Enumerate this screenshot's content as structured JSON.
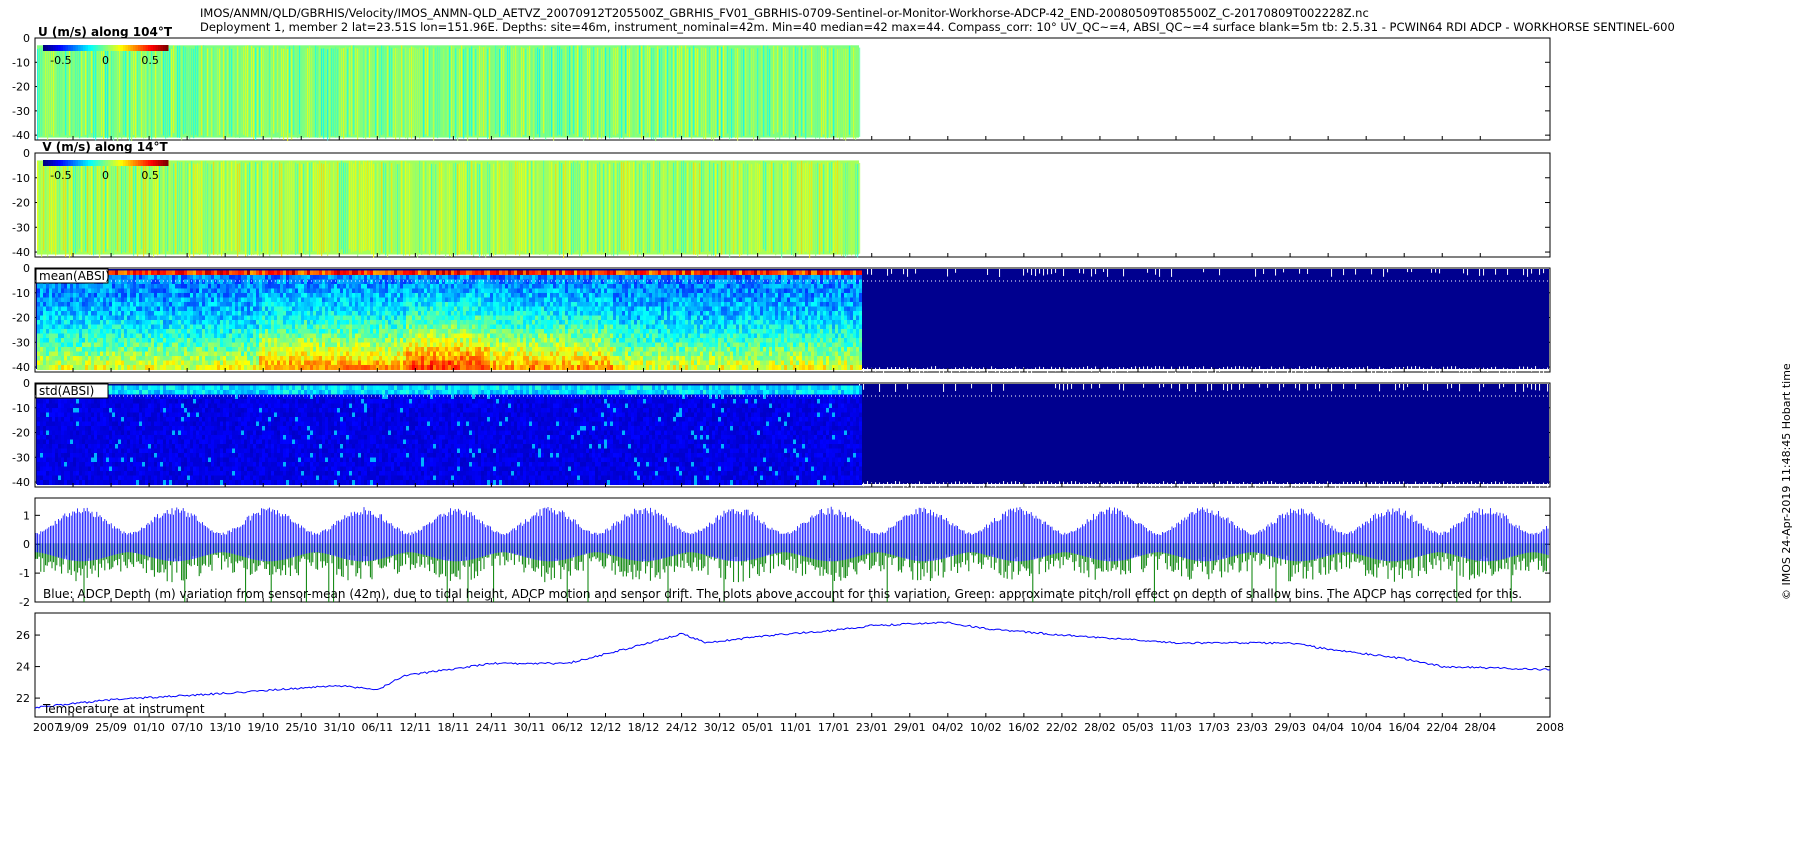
{
  "title": {
    "line1": "IMOS/ANMN/QLD/GBRHIS/Velocity/IMOS_ANMN-QLD_AETVZ_20070912T205500Z_GBRHIS_FV01_GBRHIS-0709-Sentinel-or-Monitor-Workhorse-ADCP-42_END-20080509T085500Z_C-20170809T002228Z.nc",
    "line2": "Deployment 1, member 2 lat=23.51S lon=151.96E. Depths: site=46m, instrument_nominal=42m. Min=40 median=42 max=44. Compass_corr: 10° UV_QC~=4, ABSI_QC~=4 surface blank=5m tb: 2.5.31 - PCWIN64 RDI ADCP - WORKHORSE SENTINEL-600"
  },
  "side_stamp": "© IMOS 24-Apr-2019 11:48:45 Hobart time",
  "colors": {
    "u_v_field": "#6fd23a",
    "absi_background": "#00008f",
    "depth_line": "#0000ff",
    "pitch_roll_effect": "#007f00",
    "temperature_line": "#0000ff"
  },
  "colormap": "jet",
  "chart_data": [
    {
      "type": "heatmap",
      "name": "U",
      "label": "U (m/s) along 104°T",
      "colorbar_ticks": [
        "-0.5",
        "0",
        "0.5"
      ],
      "clim": [
        -0.7,
        0.7
      ],
      "yticks": [
        "0",
        "-10",
        "-20",
        "-30",
        "-40"
      ],
      "ylim": [
        -42,
        0
      ],
      "data_end_date": "2008-01-21",
      "typical_value": 0.0
    },
    {
      "type": "heatmap",
      "name": "V",
      "label": "V (m/s) along 14°T",
      "colorbar_ticks": [
        "-0.5",
        "0",
        "0.5"
      ],
      "clim": [
        -0.7,
        0.7
      ],
      "yticks": [
        "0",
        "-10",
        "-20",
        "-30",
        "-40"
      ],
      "ylim": [
        -42,
        0
      ],
      "data_end_date": "2008-01-21",
      "typical_value": 0.05
    },
    {
      "type": "heatmap",
      "name": "mean(ABSI)",
      "label": "mean(ABSI)",
      "yticks": [
        "0",
        "-10",
        "-20",
        "-30",
        "-40"
      ],
      "ylim": [
        -42,
        0
      ],
      "data_end_date": "2008-01-21"
    },
    {
      "type": "heatmap",
      "name": "std(ABSI)",
      "label": "std(ABSI)",
      "yticks": [
        "0",
        "-10",
        "-20",
        "-30",
        "-40"
      ],
      "ylim": [
        -42,
        0
      ],
      "data_end_date": "2008-01-21"
    },
    {
      "type": "line",
      "name": "depth-variation",
      "annotation": "Blue: ADCP Depth (m) variation from sensor-mean (42m), due to tidal height, ADCP motion and sensor drift. The plots above account for this variation. Green: approximate pitch/roll effect on depth of shallow bins. The ADCP has corrected for this.",
      "yticks": [
        "1",
        "0",
        "-1",
        "-2"
      ],
      "ylim": [
        -2,
        1.6
      ],
      "series": [
        {
          "tidal_amplitude_spring": 1.4,
          "tidal_amplitude_neap": 0.5,
          "offset": -0.1
        },
        {
          "typical_min": -1.2,
          "extreme_min": -2.0
        }
      ]
    },
    {
      "type": "line",
      "name": "temperature",
      "annotation": "Temperature at instrument",
      "yticks": [
        "26",
        "24",
        "22"
      ],
      "ylim": [
        20.8,
        27.4
      ],
      "x": [
        "2007-09-13",
        "2007-09-25",
        "2007-10-13",
        "2007-10-31",
        "2007-11-06",
        "2007-11-10",
        "2007-11-24",
        "2007-12-06",
        "2007-12-18",
        "2007-12-24",
        "2007-12-28",
        "2008-01-05",
        "2008-01-17",
        "2008-01-23",
        "2008-02-04",
        "2008-02-10",
        "2008-02-16",
        "2008-02-22",
        "2008-03-05",
        "2008-03-11",
        "2008-03-29",
        "2008-04-04",
        "2008-04-16",
        "2008-04-22",
        "2008-05-09"
      ],
      "y": [
        21.4,
        21.9,
        22.3,
        22.8,
        22.5,
        23.4,
        24.2,
        24.2,
        25.4,
        26.1,
        25.5,
        25.9,
        26.3,
        26.6,
        26.8,
        26.4,
        26.2,
        26.0,
        25.7,
        25.5,
        25.5,
        25.1,
        24.5,
        24.0,
        23.8
      ]
    }
  ],
  "x_axis": {
    "start_date": "2007-09-13",
    "end_date": "2008-05-09",
    "tick_labels": [
      "19/09",
      "25/09",
      "01/10",
      "07/10",
      "13/10",
      "19/10",
      "25/10",
      "31/10",
      "06/11",
      "12/11",
      "18/11",
      "24/11",
      "30/11",
      "06/12",
      "12/12",
      "18/12",
      "24/12",
      "30/12",
      "05/01",
      "11/01",
      "17/01",
      "23/01",
      "29/01",
      "04/02",
      "10/02",
      "16/02",
      "22/02",
      "28/02",
      "05/03",
      "11/03",
      "17/03",
      "23/03",
      "29/03",
      "04/04",
      "10/04",
      "16/04",
      "22/04",
      "28/04"
    ],
    "tick_dates": [
      "2007-09-19",
      "2007-09-25",
      "2007-10-01",
      "2007-10-07",
      "2007-10-13",
      "2007-10-19",
      "2007-10-25",
      "2007-10-31",
      "2007-11-06",
      "2007-11-12",
      "2007-11-18",
      "2007-11-24",
      "2007-11-30",
      "2007-12-06",
      "2007-12-12",
      "2007-12-18",
      "2007-12-24",
      "2007-12-30",
      "2008-01-05",
      "2008-01-11",
      "2008-01-17",
      "2008-01-23",
      "2008-01-29",
      "2008-02-04",
      "2008-02-10",
      "2008-02-16",
      "2008-02-22",
      "2008-02-28",
      "2008-03-05",
      "2008-03-11",
      "2008-03-17",
      "2008-03-23",
      "2008-03-29",
      "2008-04-04",
      "2008-04-10",
      "2008-04-16",
      "2008-04-22",
      "2008-04-28"
    ],
    "year_start": "2007",
    "year_end": "2008"
  }
}
